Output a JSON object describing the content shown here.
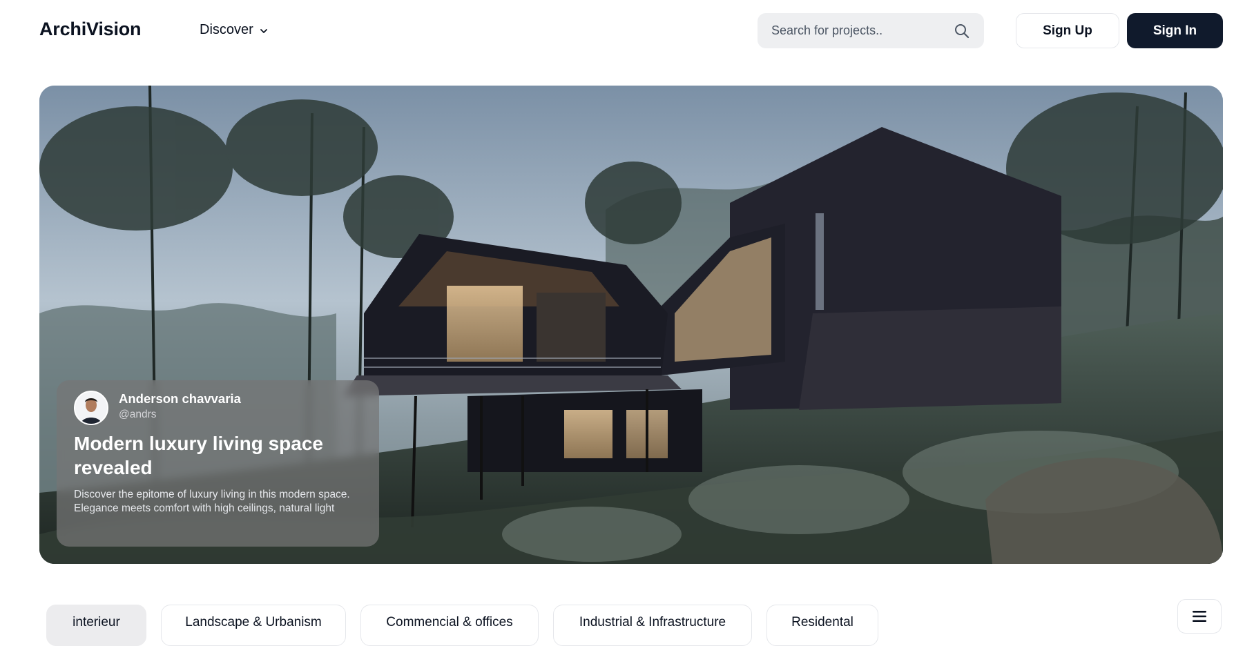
{
  "header": {
    "logo": "ArchiVision",
    "nav_discover": "Discover",
    "search_placeholder": "Search for projects..",
    "signup_label": "Sign Up",
    "signin_label": "Sign In"
  },
  "hero": {
    "author_name": "Anderson chavvaria",
    "author_handle": "@andrs",
    "title": "Modern luxury living space revealed",
    "description": "Discover the epitome of luxury living in this modern space. Elegance meets comfort with high ceilings, natural light"
  },
  "categories": [
    {
      "label": "interieur",
      "active": true
    },
    {
      "label": "Landscape & Urbanism",
      "active": false
    },
    {
      "label": "Commencial & offices",
      "active": false
    },
    {
      "label": "Industrial & Infrastructure",
      "active": false
    },
    {
      "label": "Residental",
      "active": false
    }
  ],
  "icons": {
    "search": "search-icon",
    "chevron": "chevron-down-icon",
    "menu": "menu-icon"
  },
  "colors": {
    "primary_button": "#101a2c",
    "search_bg": "#eeeff1",
    "active_tab_bg": "#ececee"
  }
}
